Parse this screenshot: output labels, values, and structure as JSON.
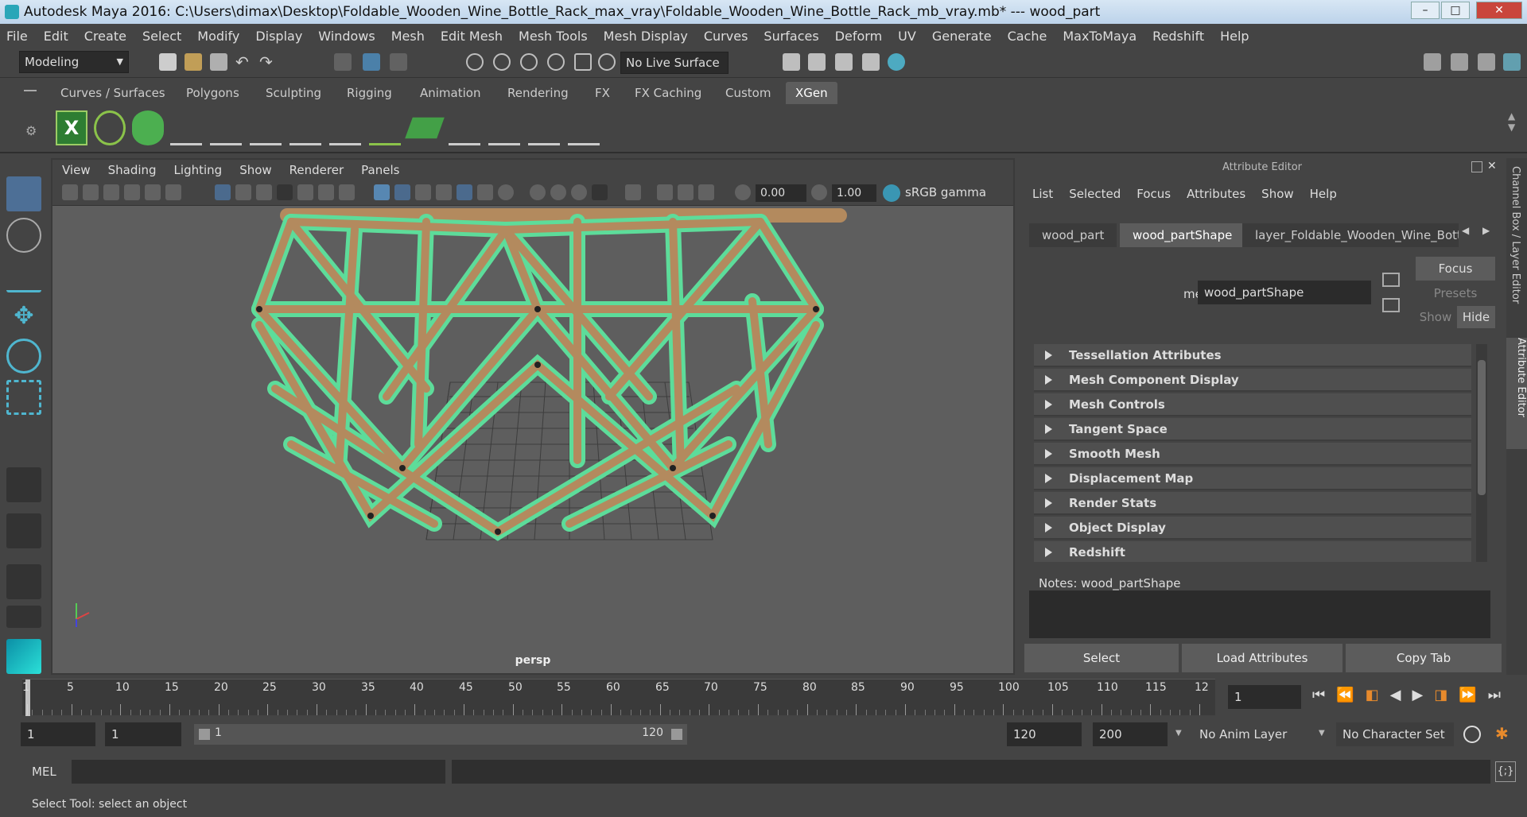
{
  "titlebar": {
    "text": "Autodesk Maya 2016: C:\\Users\\dimax\\Desktop\\Foldable_Wooden_Wine_Bottle_Rack_max_vray\\Foldable_Wooden_Wine_Bottle_Rack_mb_vray.mb*   ---   wood_part",
    "min": "–",
    "max": "□",
    "close": "✕"
  },
  "menus": [
    "File",
    "Edit",
    "Create",
    "Select",
    "Modify",
    "Display",
    "Windows",
    "Mesh",
    "Edit Mesh",
    "Mesh Tools",
    "Mesh Display",
    "Curves",
    "Surfaces",
    "Deform",
    "UV",
    "Generate",
    "Cache",
    "MaxToMaya",
    "Redshift",
    "Help"
  ],
  "status": {
    "mode": "Modeling",
    "live_surface": "No Live Surface"
  },
  "shelf_tabs": [
    "Curves / Surfaces",
    "Polygons",
    "Sculpting",
    "Rigging",
    "Animation",
    "Rendering",
    "FX",
    "FX Caching",
    "Custom",
    "XGen"
  ],
  "shelf_active": "XGen",
  "viewport": {
    "menus": [
      "View",
      "Shading",
      "Lighting",
      "Show",
      "Renderer",
      "Panels"
    ],
    "exposure": "0.00",
    "gamma": "1.00",
    "colorspace": "sRGB gamma",
    "camera": "persp"
  },
  "attribute_editor": {
    "title": "Attribute Editor",
    "menus": [
      "List",
      "Selected",
      "Focus",
      "Attributes",
      "Show",
      "Help"
    ],
    "tabs": [
      "wood_part",
      "wood_partShape",
      "layer_Foldable_Wooden_Wine_Bottl"
    ],
    "mesh_label": "mesh:",
    "mesh_value": "wood_partShape",
    "focus": "Focus",
    "presets": "Presets",
    "show": "Show",
    "hide": "Hide",
    "sections": [
      "Tessellation Attributes",
      "Mesh Component Display",
      "Mesh Controls",
      "Tangent Space",
      "Smooth Mesh",
      "Displacement Map",
      "Render Stats",
      "Object Display",
      "Redshift"
    ],
    "notes_label": "Notes:  wood_partShape",
    "buttons": {
      "select": "Select",
      "load": "Load Attributes",
      "copy": "Copy Tab"
    },
    "side_tab_1": "Channel Box / Layer Editor",
    "side_tab_2": "Attribute Editor"
  },
  "timeline": {
    "ticks": [
      "1",
      "5",
      "10",
      "15",
      "20",
      "25",
      "30",
      "35",
      "40",
      "45",
      "50",
      "55",
      "60",
      "65",
      "70",
      "75",
      "80",
      "85",
      "90",
      "95",
      "100",
      "105",
      "110",
      "115",
      "12"
    ],
    "current_frame": "1"
  },
  "range": {
    "start": "1",
    "anim_start": "1",
    "slider_start": "1",
    "slider_end": "120",
    "anim_end": "120",
    "end": "200",
    "anim_layer": "No Anim Layer",
    "char_set": "No Character Set"
  },
  "cmd": {
    "lang": "MEL"
  },
  "help": {
    "text": "Select Tool: select an object"
  },
  "colors": {
    "wire": "#5ddc9a",
    "wood": "#b38a5e",
    "panel": "#444444"
  }
}
